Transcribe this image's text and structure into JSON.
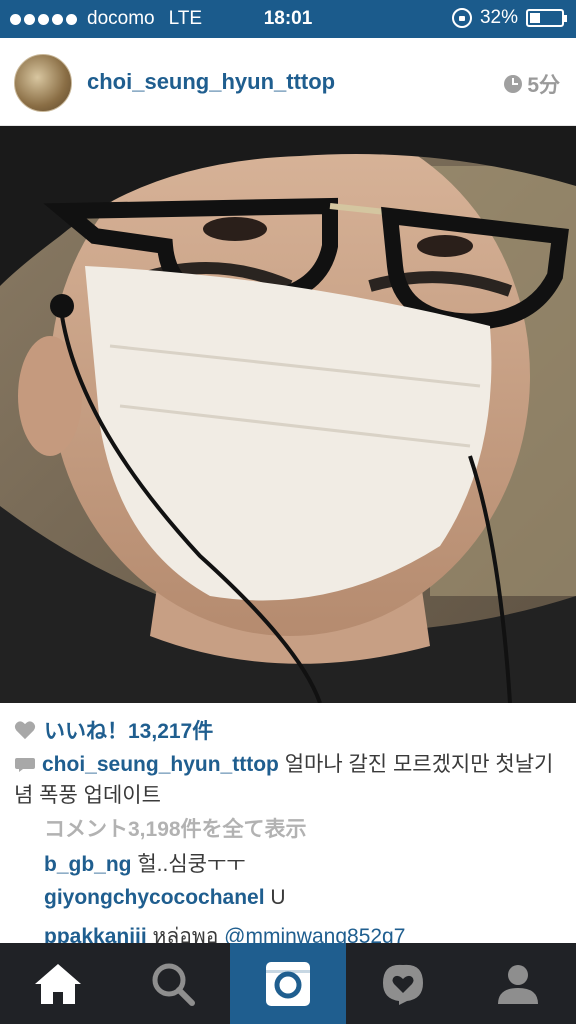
{
  "status_bar": {
    "carrier": "docomo",
    "network": "LTE",
    "time": "18:01",
    "battery": "32%",
    "battery_level": 0.32
  },
  "post": {
    "username": "choi_seung_hyun_tttop",
    "time_ago": "5分",
    "likes": "いいね！13,217件",
    "caption_user": "choi_seung_hyun_tttop",
    "caption_text": " 얼마나 갈진 모르겠지만 첫날기념 폭풍 업데이트",
    "view_all_comments": "コメント3,198件を全て表示",
    "comments": [
      {
        "user": "b_gb_ng",
        "text": " 헐..심쿵ㅜㅜ"
      },
      {
        "user": "giyongchycocochanel",
        "text": " U"
      },
      {
        "user": "ppakkanijj",
        "text": " หล่อพอ ",
        "mention": "@mminwang852g7"
      }
    ]
  },
  "tabs": [
    {
      "name": "home-icon"
    },
    {
      "name": "search-icon"
    },
    {
      "name": "camera-icon"
    },
    {
      "name": "activity-heart-icon"
    },
    {
      "name": "profile-icon"
    }
  ],
  "colors": {
    "status_bar": "#1b5b8c",
    "link_blue": "#1f5e8f",
    "tab_bar": "#202226",
    "muted": "#b2b2b2"
  }
}
